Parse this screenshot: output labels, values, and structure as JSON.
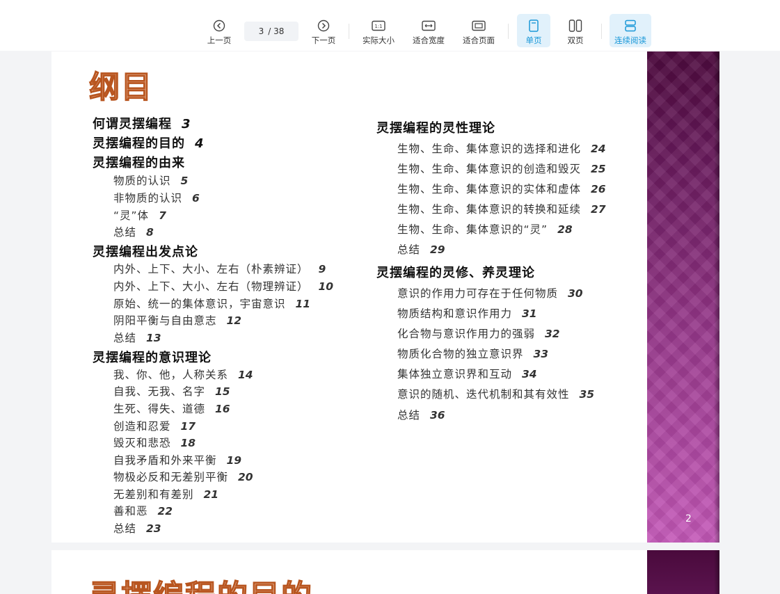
{
  "toolbar": {
    "prev": "上一页",
    "page_current": "3",
    "page_total": "/ 38",
    "next": "下一页",
    "actual_size": "实际大小",
    "fit_width": "适合宽度",
    "fit_page": "适合页面",
    "single": "单页",
    "double": "双页",
    "continuous": "连续阅读",
    "accent_color": "#1a98d8"
  },
  "page1": {
    "title": "纲目",
    "page_number": "2",
    "left_col": [
      {
        "text": "何谓灵摆编程",
        "page": "3",
        "level": 1
      },
      {
        "text": "灵摆编程的目的",
        "page": "4",
        "level": 1
      },
      {
        "text": "灵摆编程的由来",
        "page": "",
        "level": 1
      },
      {
        "text": "物质的认识",
        "page": "5",
        "level": 2
      },
      {
        "text": "非物质的认识",
        "page": "6",
        "level": 2
      },
      {
        "text": "“灵”体",
        "page": "7",
        "level": 2
      },
      {
        "text": "总结",
        "page": "8",
        "level": 2
      },
      {
        "text": "灵摆编程出发点论",
        "page": "",
        "level": 1
      },
      {
        "text": "内外、上下、大小、左右（朴素辨证）",
        "page": "9",
        "level": 2
      },
      {
        "text": "内外、上下、大小、左右（物理辨证）",
        "page": "10",
        "level": 2
      },
      {
        "text": "原始、统一的集体意识，宇宙意识",
        "page": "11",
        "level": 2
      },
      {
        "text": "阴阳平衡与自由意志",
        "page": "12",
        "level": 2
      },
      {
        "text": "总结",
        "page": "13",
        "level": 2
      },
      {
        "text": "灵摆编程的意识理论",
        "page": "",
        "level": 1
      },
      {
        "text": "我、你、他，人称关系",
        "page": "14",
        "level": 2
      },
      {
        "text": "自我、无我、名字",
        "page": "15",
        "level": 2
      },
      {
        "text": "生死、得失、道德",
        "page": "16",
        "level": 2
      },
      {
        "text": "创造和忍爱",
        "page": "17",
        "level": 2
      },
      {
        "text": "毁灭和悲恐",
        "page": "18",
        "level": 2
      },
      {
        "text": "自我矛盾和外来平衡",
        "page": "19",
        "level": 2
      },
      {
        "text": "物极必反和无差别平衡",
        "page": "20",
        "level": 2
      },
      {
        "text": "无差别和有差别",
        "page": "21",
        "level": 2
      },
      {
        "text": "善和恶",
        "page": "22",
        "level": 2
      },
      {
        "text": "总结",
        "page": "23",
        "level": 2
      }
    ],
    "right_col": [
      {
        "text": "灵摆编程的灵性理论",
        "page": "",
        "level": 1
      },
      {
        "text": "生物、生命、集体意识的选择和进化",
        "page": "24",
        "level": 2
      },
      {
        "text": "生物、生命、集体意识的创造和毁灭",
        "page": "25",
        "level": 2
      },
      {
        "text": "生物、生命、集体意识的实体和虚体",
        "page": "26",
        "level": 2
      },
      {
        "text": "生物、生命、集体意识的转换和延续",
        "page": "27",
        "level": 2
      },
      {
        "text": "生物、生命、集体意识的“灵”",
        "page": "28",
        "level": 2
      },
      {
        "text": "总结",
        "page": "29",
        "level": 2
      },
      {
        "text": "灵摆编程的灵修、养灵理论",
        "page": "",
        "level": 1
      },
      {
        "text": "意识的作用力可存在于任何物质",
        "page": "30",
        "level": 2
      },
      {
        "text": "物质结构和意识作用力",
        "page": "31",
        "level": 2
      },
      {
        "text": "化合物与意识作用力的强弱",
        "page": "32",
        "level": 2
      },
      {
        "text": "物质化合物的独立意识界",
        "page": "33",
        "level": 2
      },
      {
        "text": "集体独立意识界和互动",
        "page": "34",
        "level": 2
      },
      {
        "text": "意识的随机、迭代机制和其有效性",
        "page": "35",
        "level": 2
      },
      {
        "text": "总结",
        "page": "36",
        "level": 2
      }
    ]
  },
  "page2": {
    "title": "灵摆编程的目的"
  }
}
